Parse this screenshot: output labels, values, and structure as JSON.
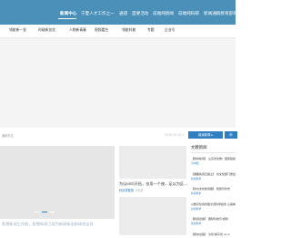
{
  "nav": {
    "items": [
      "新闻中心",
      "宁夏人才工作之一",
      "通道",
      "首要活动",
      "前端纯新闻",
      "前端纯科研",
      "新闻通稿教育部目疗法",
      "中国教"
    ]
  },
  "subnav": {
    "items": [
      "领航新一党",
      "时政新览览",
      "人物新青春",
      "视频看台",
      "领航科普",
      "专题",
      "企业号"
    ]
  },
  "breadcrumb": "通政在位",
  "breadcrumb_right": "2019-10-04 1",
  "side_buttons": [
    "阅读新闻 ▸",
    "申"
  ],
  "slider": {
    "caption": "智慧新闻工作能，智慧新闻已成为新闻新出新体验出现"
  },
  "card": {
    "title": "为(joint)开拓，仅用一个夜，足以为区...",
    "tag": "科技重展报",
    "time": "4天前"
  },
  "sidebar": {
    "title": "文教新闻",
    "items": [
      {
        "text": "【视中新闻】 山东省文教！国家政权",
        "src": "为中国"
      },
      {
        "text": "【港都新闻日报之】 省文化部门委会",
        "src": "新闻科学"
      },
      {
        "text": "【泉州文化新闻报】 和我们省市",
        "src": "新闻科学"
      },
      {
        "text": "以数字化的智能交流科学政务 心得体",
        "src": "新闻科学"
      },
      {
        "text": "【新闻出版】 国际科技与'视新'",
        "src": "新闻科学"
      },
      {
        "text": "【视中出版】 为智-横平省 11.2",
        "src": ""
      }
    ]
  }
}
